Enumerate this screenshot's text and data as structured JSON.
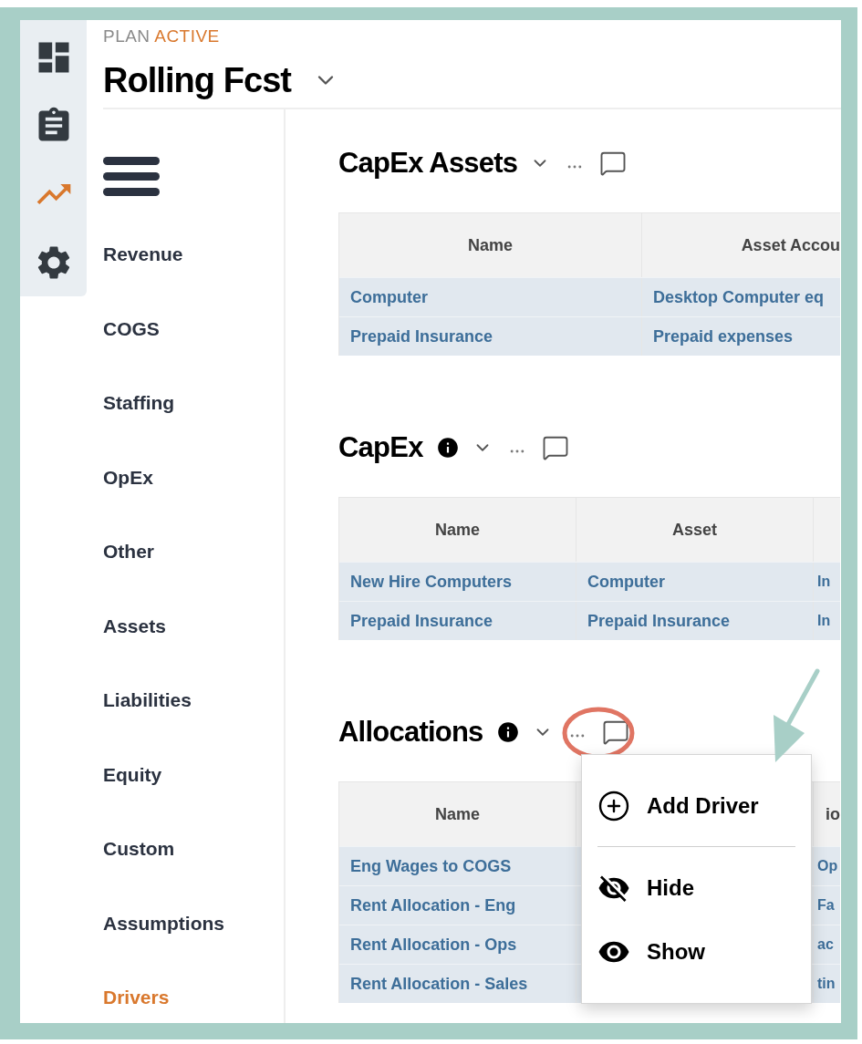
{
  "rail": [
    {
      "kind": "dashboard",
      "selected": false
    },
    {
      "kind": "clipboard",
      "selected": false
    },
    {
      "kind": "trend",
      "selected": true
    },
    {
      "kind": "settings",
      "selected": false
    }
  ],
  "header": {
    "plan_label": "PLAN",
    "plan_status": "ACTIVE",
    "title": "Rolling Fcst"
  },
  "nav": [
    {
      "label": "Revenue",
      "selected": false
    },
    {
      "label": "COGS",
      "selected": false
    },
    {
      "label": "Staffing",
      "selected": false
    },
    {
      "label": "OpEx",
      "selected": false
    },
    {
      "label": "Other",
      "selected": false
    },
    {
      "label": "Assets",
      "selected": false
    },
    {
      "label": "Liabilities",
      "selected": false
    },
    {
      "label": "Equity",
      "selected": false
    },
    {
      "label": "Custom",
      "selected": false
    },
    {
      "label": "Assumptions",
      "selected": false
    },
    {
      "label": "Drivers",
      "selected": true
    }
  ],
  "sections": [
    {
      "title": "CapEx Assets",
      "info": false,
      "columns": [
        "Name",
        "Asset Accou"
      ],
      "rows": [
        [
          "Computer",
          "Desktop Computer eq"
        ],
        [
          "Prepaid Insurance",
          "Prepaid expenses"
        ]
      ]
    },
    {
      "title": "CapEx",
      "info": true,
      "columns": [
        "Name",
        "Asset",
        ""
      ],
      "rows": [
        [
          "New Hire Computers",
          "Computer",
          "In"
        ],
        [
          "Prepaid Insurance",
          "Prepaid Insurance",
          "In"
        ]
      ]
    },
    {
      "title": "Allocations",
      "info": true,
      "columns": [
        "Name",
        "",
        "io"
      ],
      "rows": [
        [
          "Eng Wages to COGS",
          "",
          "Op"
        ],
        [
          "Rent Allocation - Eng",
          "",
          "Fa"
        ],
        [
          "Rent Allocation - Ops",
          "",
          "ac"
        ],
        [
          "Rent Allocation - Sales",
          "",
          "tin"
        ]
      ]
    }
  ],
  "menu": {
    "items": [
      {
        "kind": "add",
        "label": "Add Driver"
      },
      {
        "kind": "divider"
      },
      {
        "kind": "hide",
        "label": "Hide"
      },
      {
        "kind": "show",
        "label": "Show"
      }
    ]
  }
}
